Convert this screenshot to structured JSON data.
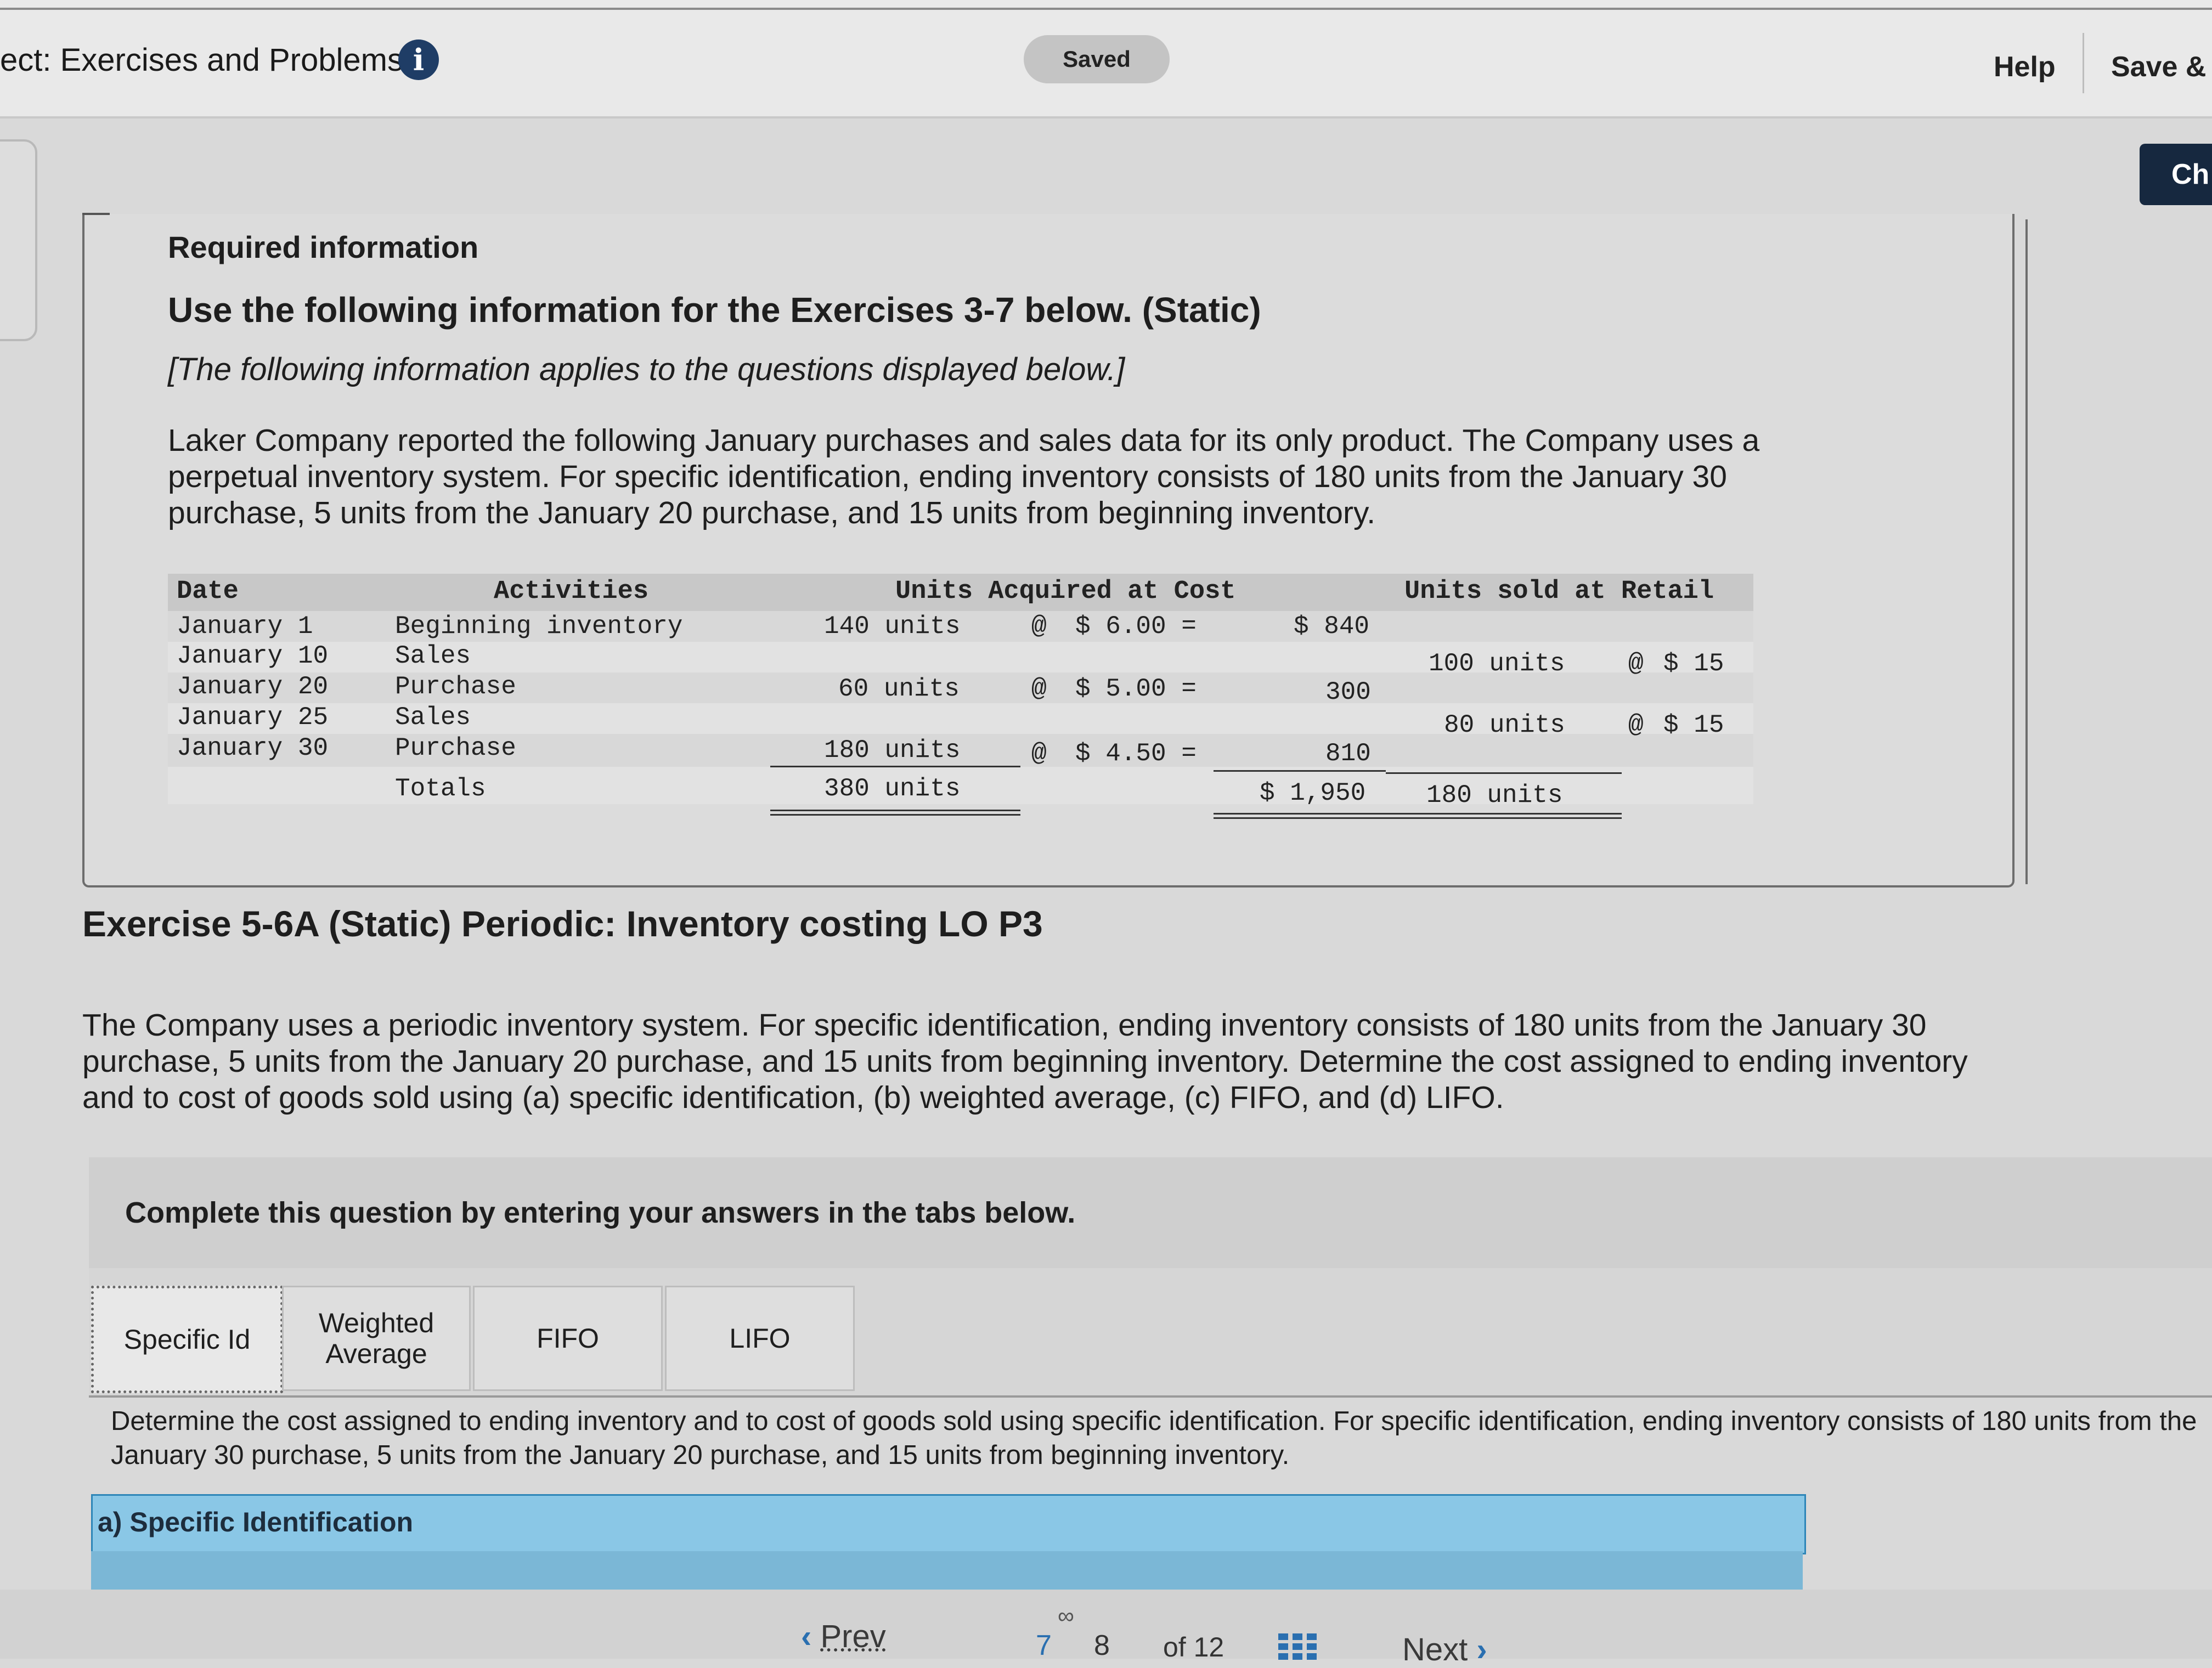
{
  "header": {
    "title": "ect: Exercises and Problems",
    "info_icon_glyph": "i",
    "saved_label": "Saved",
    "help_label": "Help",
    "save_exit_label": "Save &",
    "check_label": "Ch"
  },
  "info_box": {
    "required_label": "Required information",
    "use_label": "Use the following information for the Exercises 3-7 below. (Static)",
    "applies_label": "[The following information applies to the questions displayed below.]",
    "intro": "Laker Company reported the following January purchases and sales data for its only product. The Company uses a perpetual inventory system. For specific identification, ending inventory consists of 180 units from the January 30 purchase, 5 units from the January 20 purchase, and 15 units from beginning inventory."
  },
  "table": {
    "headers": {
      "date": "Date",
      "activities": "Activities",
      "acquired": "Units Acquired at Cost",
      "sold": "Units sold at Retail"
    },
    "rows": [
      {
        "date": "January 1",
        "activity": "Beginning inventory",
        "acq_units": "140 units",
        "at": "@",
        "acq_cost": "$ 6.00 =",
        "acq_total": "$ 840",
        "sold_units": "",
        "sold_at": "",
        "sold_price": ""
      },
      {
        "date": "January 10",
        "activity": "Sales",
        "acq_units": "",
        "at": "",
        "acq_cost": "",
        "acq_total": "",
        "sold_units": "100 units",
        "sold_at": "@",
        "sold_price": "$ 15"
      },
      {
        "date": "January 20",
        "activity": "Purchase",
        "acq_units": "60 units",
        "at": "@",
        "acq_cost": "$ 5.00 =",
        "acq_total": "300",
        "sold_units": "",
        "sold_at": "",
        "sold_price": ""
      },
      {
        "date": "January 25",
        "activity": "Sales",
        "acq_units": "",
        "at": "",
        "acq_cost": "",
        "acq_total": "",
        "sold_units": "80 units",
        "sold_at": "@",
        "sold_price": "$ 15"
      },
      {
        "date": "January 30",
        "activity": "Purchase",
        "acq_units": "180 units",
        "at": "@",
        "acq_cost": "$ 4.50 =",
        "acq_total": "810",
        "sold_units": "",
        "sold_at": "",
        "sold_price": ""
      }
    ],
    "totals": {
      "label": "Totals",
      "acq_units": "380 units",
      "acq_total": "$ 1,950",
      "sold_units": "180 units"
    }
  },
  "exercise": {
    "title": "Exercise 5-6A (Static) Periodic: Inventory costing LO P3",
    "text": "The Company uses a periodic inventory system. For specific identification, ending inventory consists of 180 units from the January 30 purchase, 5 units from the January 20 purchase, and 15 units from beginning inventory. Determine the cost assigned to ending inventory and to cost of goods sold using (a) specific identification, (b) weighted average, (c) FIFO, and (d) LIFO."
  },
  "tabs_section": {
    "instruction": "Complete this question by entering your answers in the tabs below.",
    "tabs": [
      {
        "label": "Specific Id"
      },
      {
        "label": "Weighted Average"
      },
      {
        "label": "FIFO"
      },
      {
        "label": "LIFO"
      }
    ],
    "active_index": 0,
    "panel_text": "Determine the cost assigned to ending inventory and to cost of goods sold using specific identification. For specific identification, ending inventory consists of 180 units from the January 30 purchase, 5 units from the January 20 purchase, and 15 units from beginning inventory.",
    "panel_heading": "a) Specific Identification"
  },
  "pagination": {
    "prev_label": "Prev",
    "current_page": "7",
    "next_page": "8",
    "of_label": "of 12",
    "next_label": "Next",
    "link_icon": "link-icon",
    "grid_icon": "grid-icon"
  },
  "colors": {
    "accent": "#2a6fb0",
    "check_button": "#16283f",
    "heading_bar": "#8ac7e6"
  }
}
